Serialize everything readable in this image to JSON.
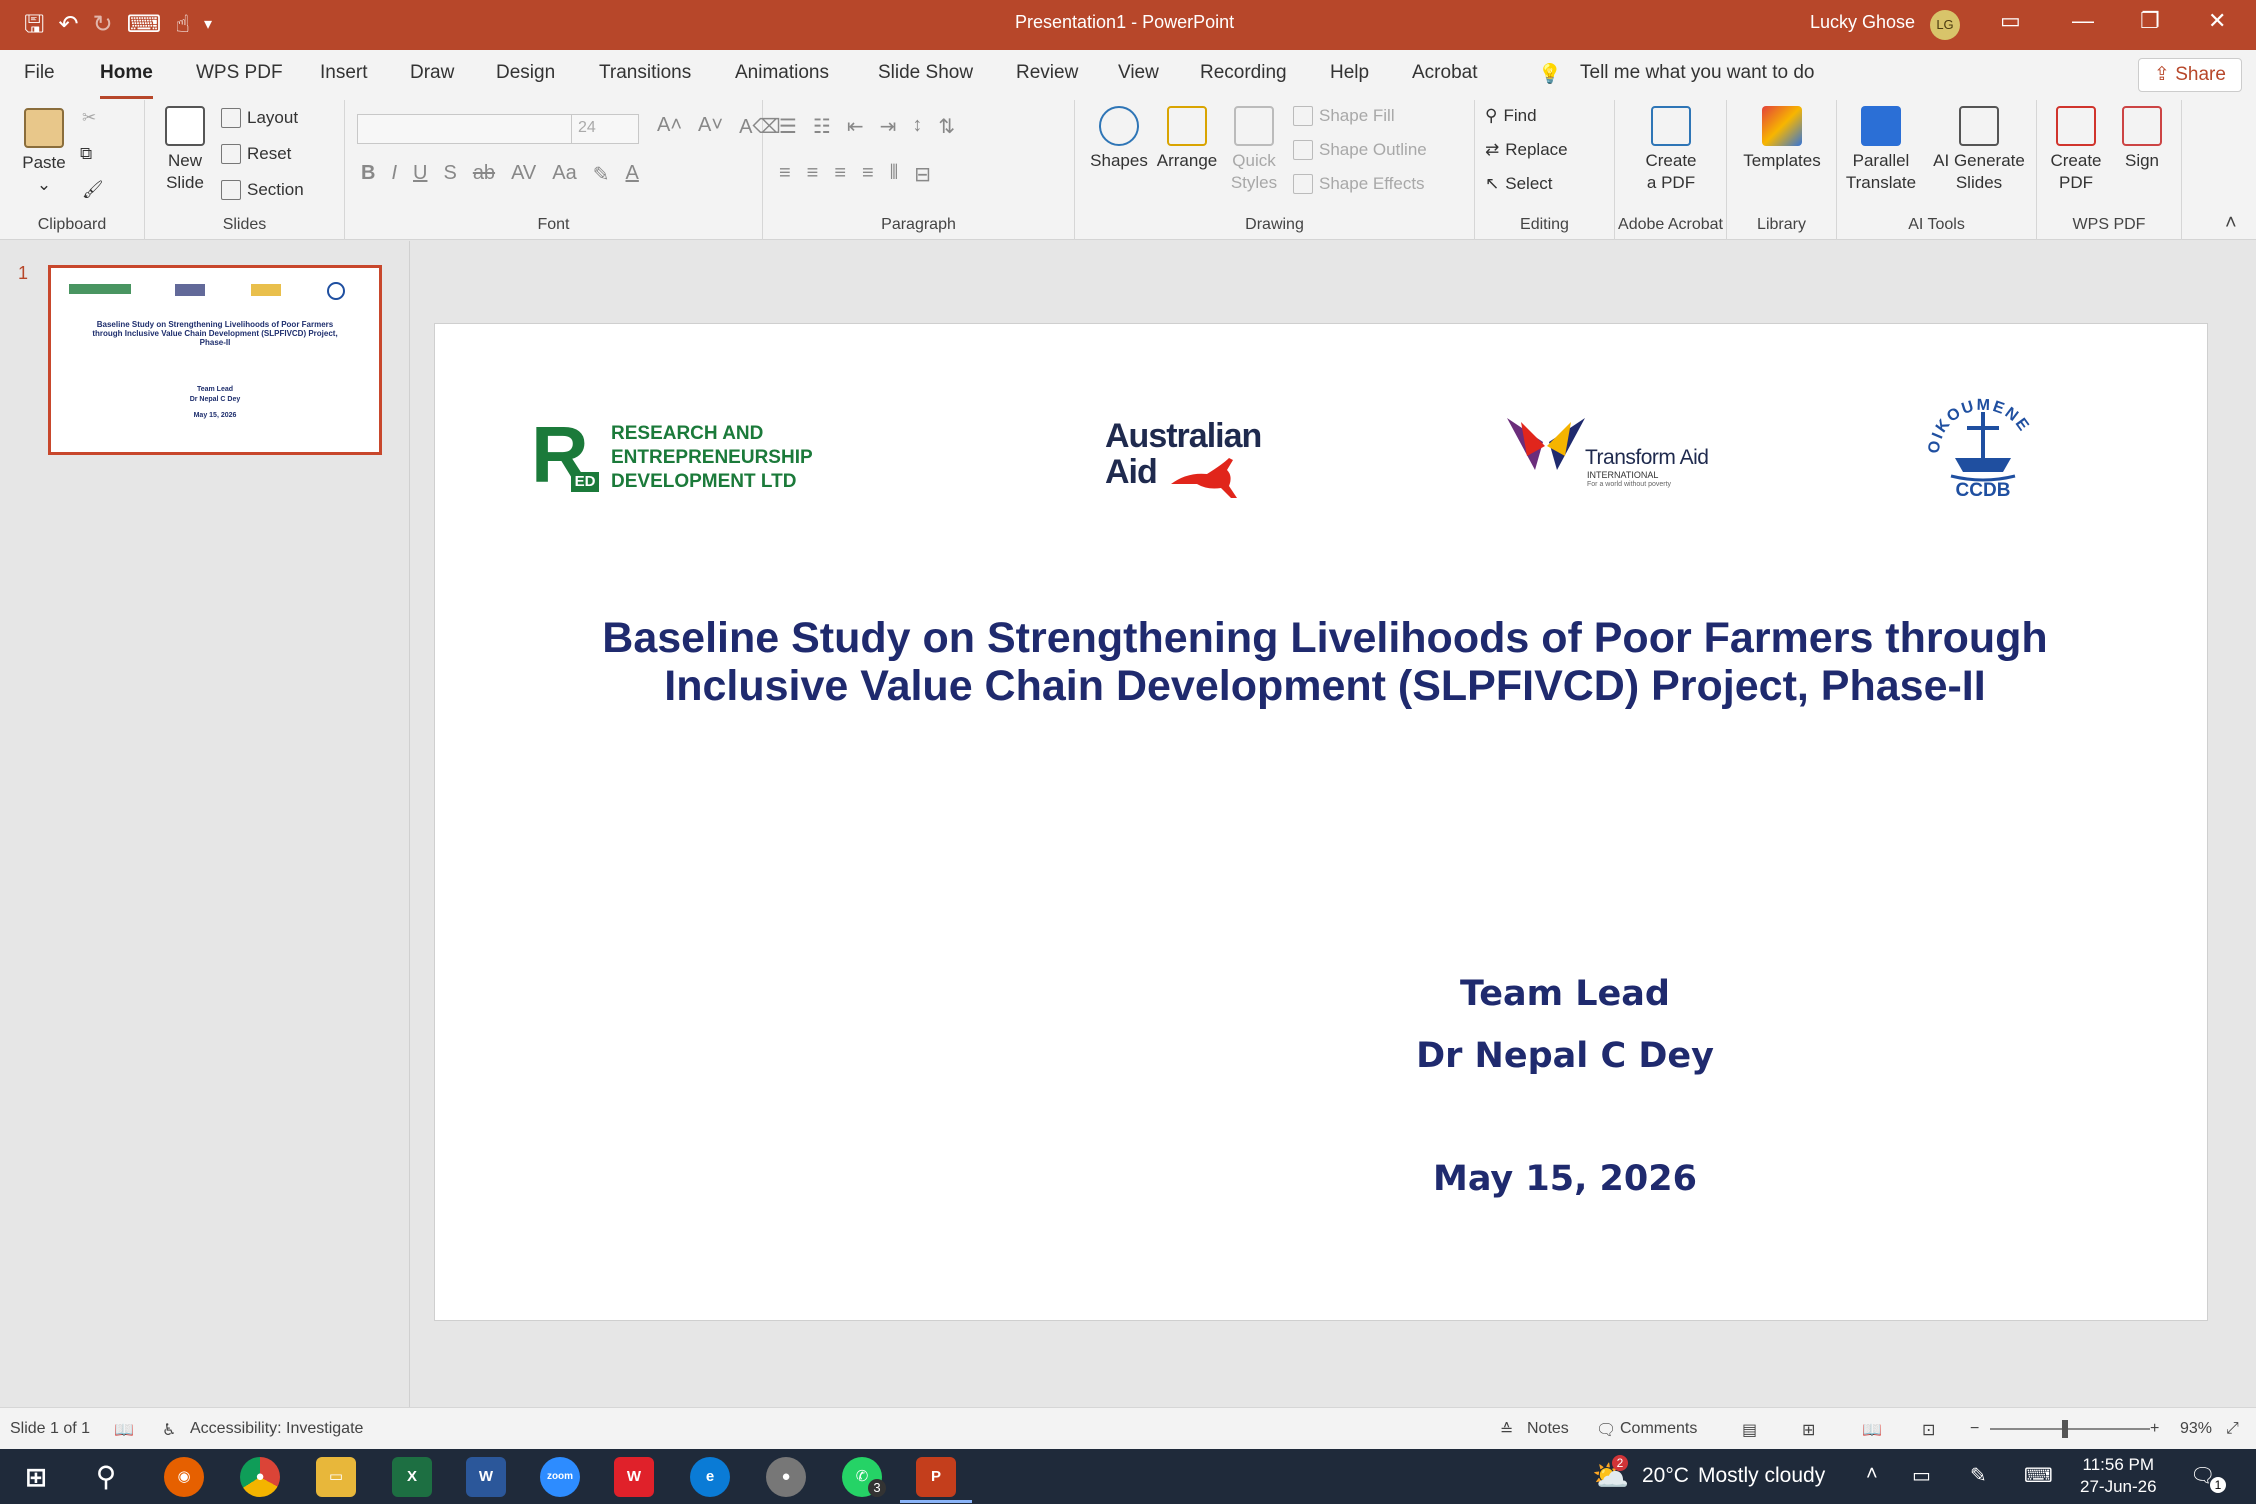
{
  "titlebar": {
    "title": "Presentation1  -  PowerPoint",
    "user_name": "Lucky Ghose",
    "user_initials": "LG"
  },
  "menu": {
    "tabs": [
      "File",
      "Home",
      "WPS PDF",
      "Insert",
      "Draw",
      "Design",
      "Transitions",
      "Animations",
      "Slide Show",
      "Review",
      "View",
      "Recording",
      "Help",
      "Acrobat"
    ],
    "active_tab": "Home",
    "tell_me": "Tell me what you want to do",
    "share": "Share"
  },
  "ribbon": {
    "clipboard": {
      "label": "Clipboard",
      "paste": "Paste"
    },
    "slides": {
      "label": "Slides",
      "new_slide": "New",
      "new_slide2": "Slide",
      "layout": "Layout",
      "reset": "Reset",
      "section": "Section"
    },
    "font": {
      "label": "Font",
      "font_size": "24"
    },
    "paragraph": {
      "label": "Paragraph"
    },
    "drawing": {
      "label": "Drawing",
      "shapes": "Shapes",
      "arrange": "Arrange",
      "quick": "Quick",
      "styles": "Styles",
      "shape_fill": "Shape Fill",
      "shape_outline": "Shape Outline",
      "shape_effects": "Shape Effects"
    },
    "editing": {
      "label": "Editing",
      "find": "Find",
      "replace": "Replace",
      "select": "Select"
    },
    "acrobat": {
      "label": "Adobe Acrobat",
      "create": "Create",
      "a_pdf": "a PDF"
    },
    "library": {
      "label": "Library",
      "templates": "Templates"
    },
    "ai_tools": {
      "label": "AI Tools",
      "parallel": "Parallel",
      "translate": "Translate",
      "ai_generate": "AI Generate",
      "slides": "Slides"
    },
    "wps_pdf": {
      "label": "WPS PDF",
      "create": "Create",
      "pdf": "PDF",
      "sign": "Sign"
    }
  },
  "thumbnail": {
    "number": "1",
    "title": "Baseline Study on Strengthening Livelihoods of Poor Farmers through Inclusive Value Chain Development (SLPFIVCD) Project, Phase-II",
    "team_lead": "Team Lead",
    "name": "Dr Nepal C Dey",
    "date": "May 15, 2026"
  },
  "slide": {
    "logos": {
      "red_line1": "RESEARCH AND",
      "red_line2": "ENTREPRENEURSHIP",
      "red_line3": "DEVELOPMENT LTD",
      "red_mark": "R",
      "red_sub": "ED",
      "aus_line1": "Australian",
      "aus_line2": "Aid",
      "transform": "Transform Aid",
      "transform_sub": "INTERNATIONAL",
      "transform_tag": "For a world without poverty",
      "oikoumene": "OIKOUMENE",
      "ccdb": "CCDB"
    },
    "title_line1": "Baseline Study on Strengthening Livelihoods of Poor Farmers through",
    "title_line2": "Inclusive Value Chain Development (SLPFIVCD) Project, Phase-II",
    "team_lead": "Team Lead",
    "name": "Dr Nepal C Dey",
    "date": "May 15, 2026"
  },
  "statusbar": {
    "slide_count": "Slide 1 of 1",
    "accessibility": "Accessibility: Investigate",
    "notes": "Notes",
    "comments": "Comments",
    "zoom": "93%",
    "zoom_level_fraction": 0.47
  },
  "taskbar": {
    "weather_temp": "20°C",
    "weather_desc": "Mostly cloudy",
    "weather_badge": "2",
    "time": "11:56 PM",
    "date": "27-Jun-26",
    "notif_count": "1",
    "whatsapp_badge": "3",
    "zoom_app": "zoom"
  },
  "colors": {
    "accent": "#b7472a",
    "title_navy": "#1f2a6e",
    "red_green": "#1b7a3a"
  }
}
